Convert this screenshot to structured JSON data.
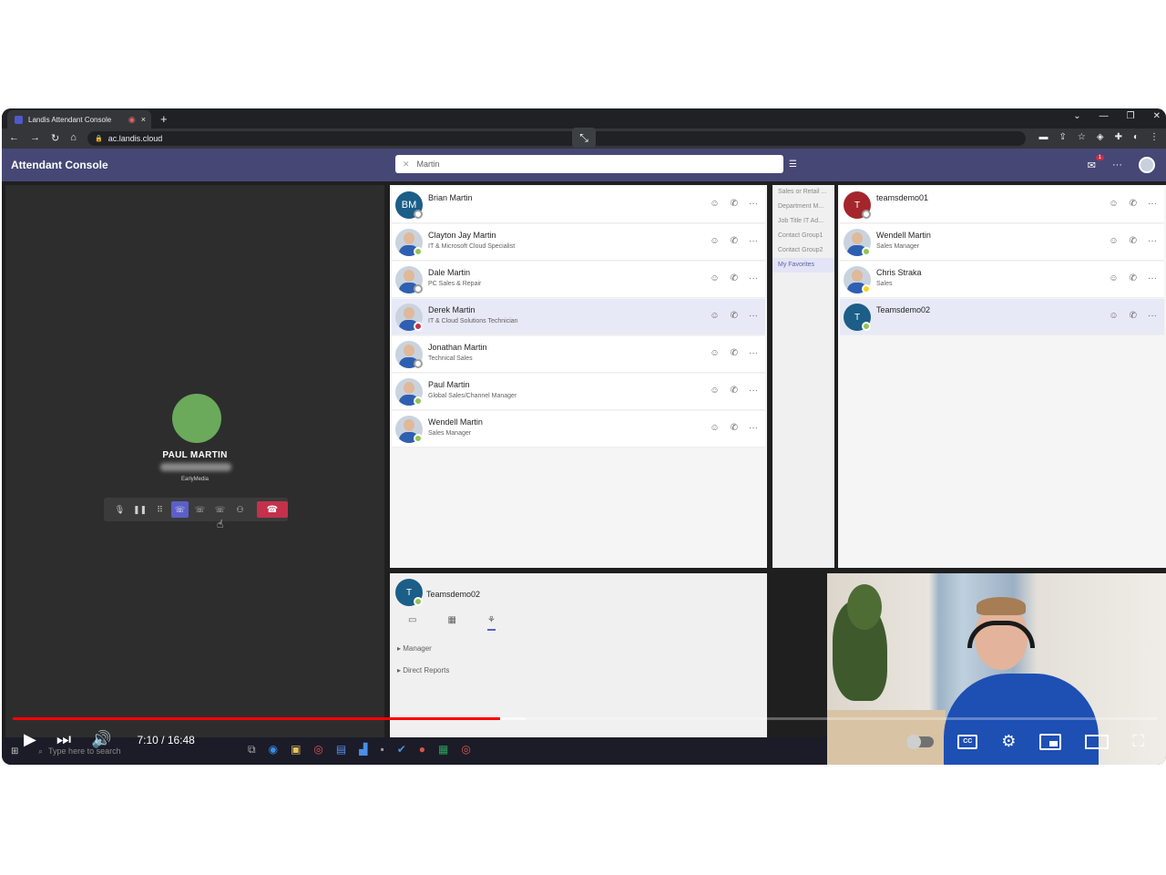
{
  "browser": {
    "tab_title": "Landis Attendant Console",
    "tab_close": "×",
    "new_tab": "+",
    "url": "ac.landis.cloud",
    "window_controls": [
      "⌄",
      "—",
      "❐",
      "✕"
    ]
  },
  "app": {
    "title": "Attendant Console",
    "search_value": "Martin",
    "mail_badge": "1"
  },
  "call": {
    "caller_name": "PAUL MARTIN",
    "state": "EarlyMedia"
  },
  "results": [
    {
      "name": "Brian Martin",
      "title": "",
      "initials": "BM",
      "presence": "off"
    },
    {
      "name": "Clayton Jay Martin",
      "title": "IT & Microsoft Cloud Specialist",
      "presence": "available"
    },
    {
      "name": "Dale Martin",
      "title": "PC Sales & Repair",
      "presence": "off"
    },
    {
      "name": "Derek Martin",
      "title": "IT & Cloud Solutions Technician",
      "presence": "busy"
    },
    {
      "name": "Jonathan Martin",
      "title": "Technical Sales",
      "presence": "off"
    },
    {
      "name": "Paul Martin",
      "title": "Global Sales/Channel Manager",
      "presence": "available"
    },
    {
      "name": "Wendell Martin",
      "title": "Sales Manager",
      "presence": "available"
    }
  ],
  "groups": [
    "Sales or Retail ...",
    "Department M...",
    "Job Title IT Ad...",
    "Contact Group1",
    "Contact Group2",
    "My Favorites"
  ],
  "favorites": [
    {
      "name": "teamsdemo01",
      "title": "",
      "initials": "T",
      "presence": "off"
    },
    {
      "name": "Wendell Martin",
      "title": "Sales Manager",
      "presence": "available"
    },
    {
      "name": "Chris Straka",
      "title": "Sales",
      "presence": "away"
    },
    {
      "name": "Teamsdemo02",
      "title": "",
      "initials": "T",
      "presence": "available"
    }
  ],
  "detail": {
    "name": "Teamsdemo02",
    "initials": "T",
    "sections": [
      "Manager",
      "Direct Reports"
    ]
  },
  "taskbar": {
    "search_placeholder": "Type here to search"
  },
  "player": {
    "time": "7:10 / 16:48",
    "progress_fraction": 0.426,
    "buffered_fraction": 0.448
  },
  "colors": {
    "teams_purple": "#464775",
    "accent": "#5b5fc7",
    "hangup_red": "#c4314b",
    "youtube_red": "#ff0000"
  }
}
